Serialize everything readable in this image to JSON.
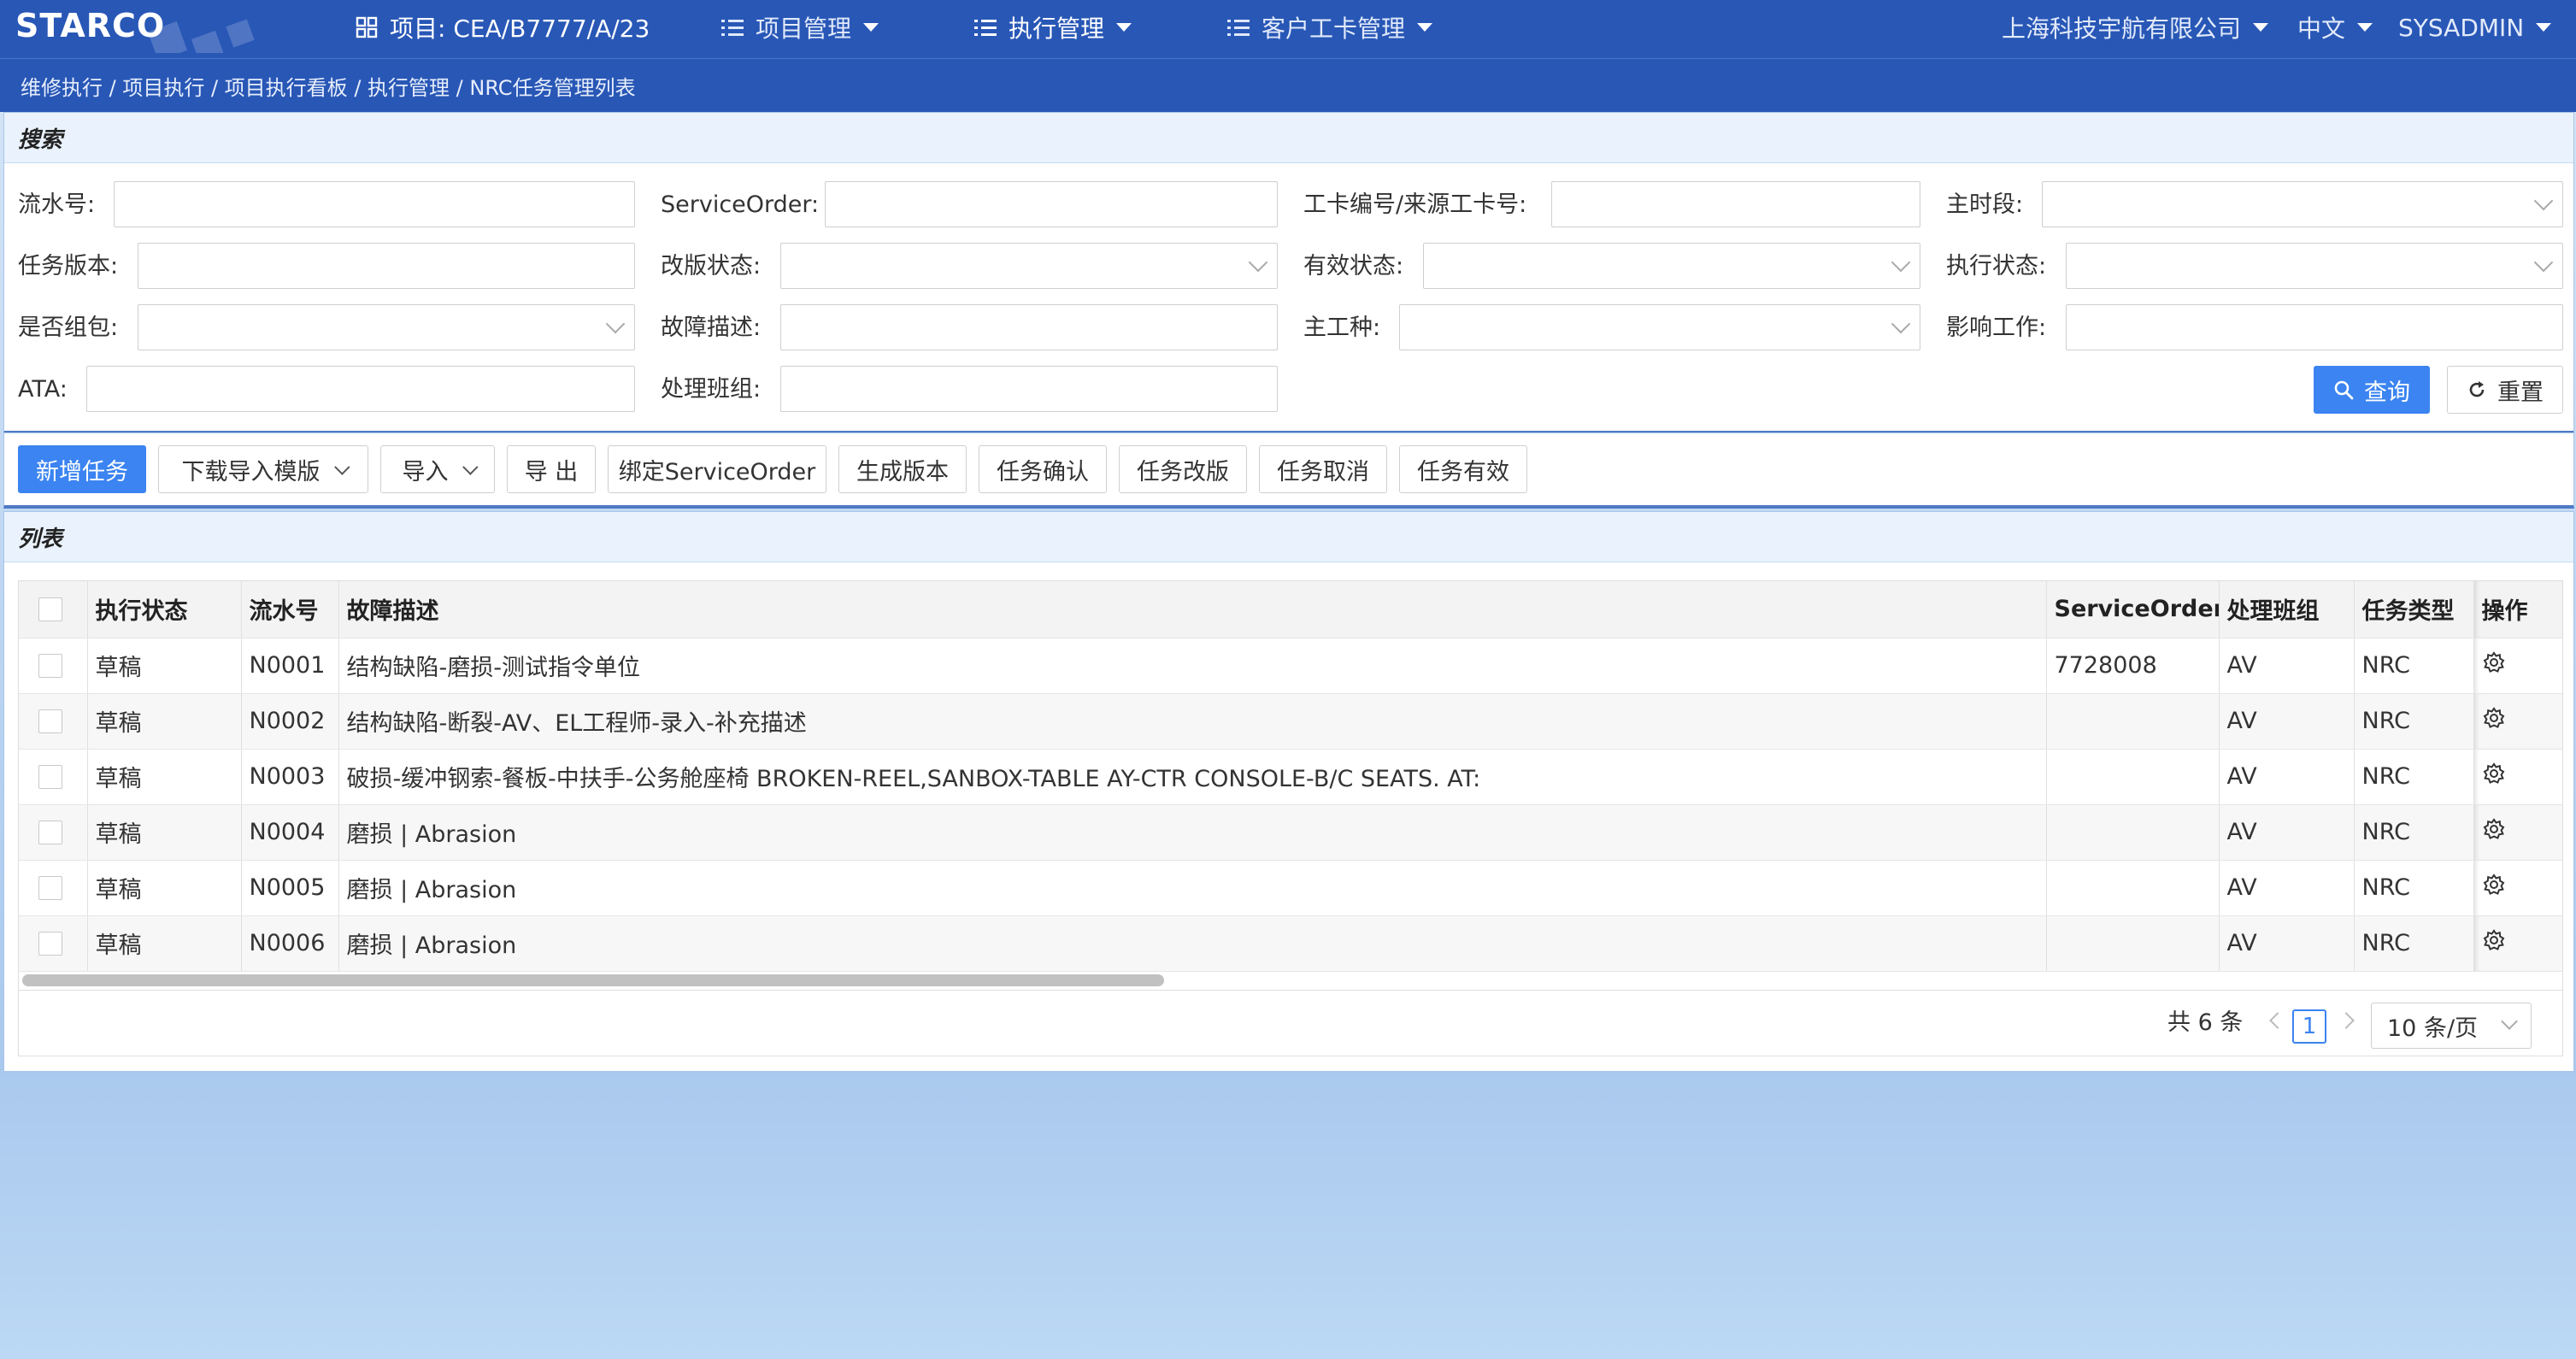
{
  "header": {
    "logo": "STARCO",
    "project_label": "项目: CEA/B7777/A/23",
    "nav": [
      "项目管理",
      "执行管理",
      "客户工卡管理"
    ],
    "company": "上海科技宇航有限公司",
    "language": "中文",
    "user": "SYSADMIN"
  },
  "breadcrumb": "维修执行 / 项目执行 / 项目执行看板 / 执行管理 / NRC任务管理列表",
  "search": {
    "title": "搜索",
    "labels": {
      "serial": "流水号:",
      "service_order": "ServiceOrder:",
      "card_no": "工卡编号/来源工卡号:",
      "period": "主时段:",
      "version": "任务版本:",
      "revision_status": "改版状态:",
      "valid_status": "有效状态:",
      "exec_status": "执行状态:",
      "packaged": "是否组包:",
      "fault_desc": "故障描述:",
      "main_trade": "主工种:",
      "impact_work": "影响工作:",
      "ata": "ATA:",
      "team": "处理班组:"
    },
    "query_button": "查询",
    "reset_button": "重置"
  },
  "toolbar": {
    "buttons": [
      "新增任务",
      "下载导入模版",
      "导入",
      "导 出",
      "绑定ServiceOrder",
      "生成版本",
      "任务确认",
      "任务改版",
      "任务取消",
      "任务有效"
    ]
  },
  "list": {
    "title": "列表",
    "columns": [
      "执行状态",
      "流水号",
      "故障描述",
      "ServiceOrder",
      "处理班组",
      "任务类型",
      "操作"
    ],
    "rows": [
      {
        "status": "草稿",
        "serial": "N0001",
        "desc": "结构缺陷-磨损-测试指令单位",
        "service_order": "7728008",
        "team": "AV",
        "type": "NRC"
      },
      {
        "status": "草稿",
        "serial": "N0002",
        "desc": "结构缺陷-断裂-AV、EL工程师-录入-补充描述",
        "service_order": "",
        "team": "AV",
        "type": "NRC"
      },
      {
        "status": "草稿",
        "serial": "N0003",
        "desc": "破损-缓冲钢索-餐板-中扶手-公务舱座椅 BROKEN-REEL,SANBOX-TABLE AY-CTR CONSOLE-B/C SEATS. AT:",
        "service_order": "",
        "team": "AV",
        "type": "NRC"
      },
      {
        "status": "草稿",
        "serial": "N0004",
        "desc": "磨损 | Abrasion",
        "service_order": "",
        "team": "AV",
        "type": "NRC"
      },
      {
        "status": "草稿",
        "serial": "N0005",
        "desc": "磨损 | Abrasion",
        "service_order": "",
        "team": "AV",
        "type": "NRC"
      },
      {
        "status": "草稿",
        "serial": "N0006",
        "desc": "磨损 | Abrasion",
        "service_order": "",
        "team": "AV",
        "type": "NRC"
      }
    ]
  },
  "pagination": {
    "total": "共 6 条",
    "current_page": "1",
    "page_size": "10 条/页"
  }
}
